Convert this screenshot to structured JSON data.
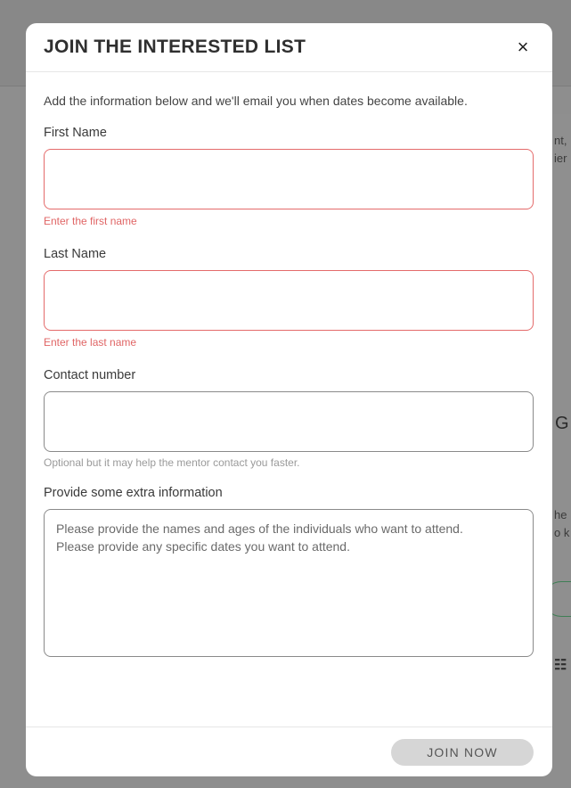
{
  "background": {
    "fragments": [
      "nt,",
      "ier",
      "G",
      "he",
      "o k"
    ],
    "glyph": "☷"
  },
  "modal": {
    "title": "JOIN THE INTERESTED LIST",
    "close_label": "×",
    "intro": "Add the information below and we'll email you when dates become available.",
    "fields": {
      "first_name": {
        "label": "First Name",
        "value": "",
        "error": "Enter the first name"
      },
      "last_name": {
        "label": "Last Name",
        "value": "",
        "error": "Enter the last name"
      },
      "contact": {
        "label": "Contact number",
        "value": "",
        "hint": "Optional but it may help the mentor contact you faster."
      },
      "extra": {
        "label": "Provide some extra information",
        "placeholder": "Please provide the names and ages of the individuals who want to attend.\nPlease provide any specific dates you want to attend."
      }
    },
    "submit_label": "JOIN NOW"
  },
  "colors": {
    "error": "#e46b6b",
    "button_bg": "#d6d6d6",
    "overlay": "#8e8e8e"
  }
}
